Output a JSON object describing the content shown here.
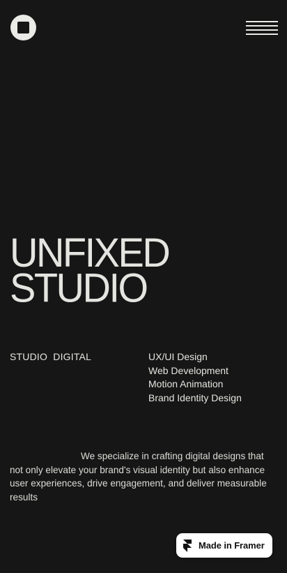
{
  "header": {
    "logo_icon": "circle-square-logo-icon",
    "menu_icon": "hamburger-menu-icon"
  },
  "hero": {
    "title_line1": "UNFIXED",
    "title_line2": "STUDIO"
  },
  "info": {
    "label": "STUDIO  DIGITAL",
    "services": [
      "UX/UI Design",
      "Web Development",
      "Motion Animation",
      "Brand Identity Design"
    ]
  },
  "intro": {
    "text": "We specialize in crafting digital designs that not only elevate your brand's visual identity but also enhance user experiences, drive engagement, and deliver measurable results"
  },
  "badge": {
    "label": "Made in Framer",
    "icon": "framer-logo-icon"
  },
  "colors": {
    "background": "#161616",
    "foreground": "#e4e4e0",
    "badge_bg": "#ffffff"
  }
}
